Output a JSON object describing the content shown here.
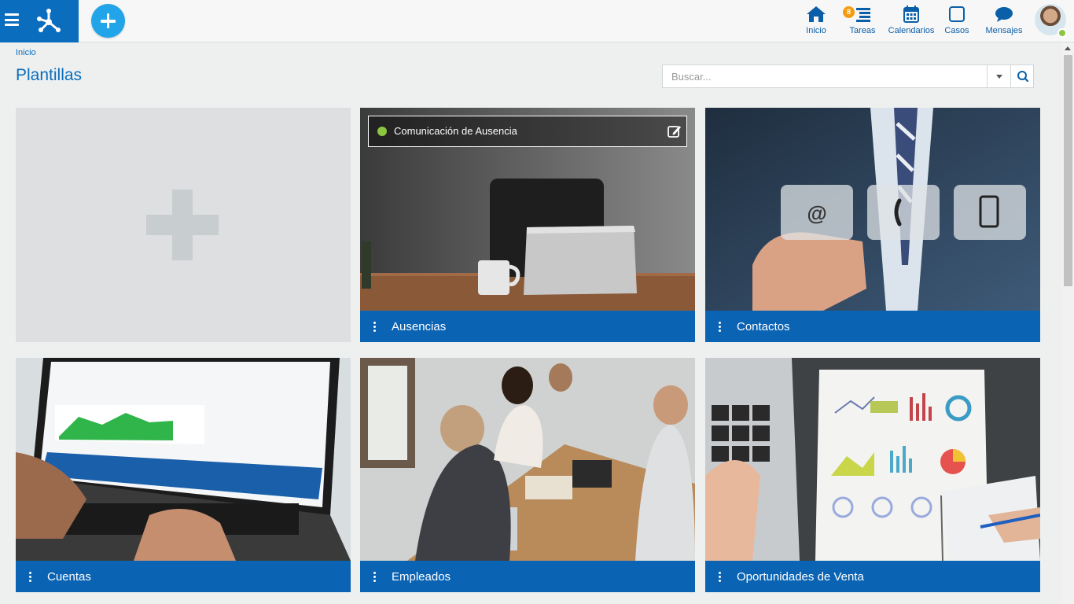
{
  "app": {
    "nav": [
      {
        "label": "Inicio",
        "icon": "home-icon"
      },
      {
        "label": "Tareas",
        "icon": "tasks-icon",
        "badge": "8"
      },
      {
        "label": "Calendarios",
        "icon": "calendar-icon"
      },
      {
        "label": "Casos",
        "icon": "cases-icon"
      },
      {
        "label": "Mensajes",
        "icon": "messages-icon"
      }
    ],
    "user_status_color": "#8cc63f"
  },
  "header": {
    "breadcrumb": "Inicio",
    "title": "Plantillas"
  },
  "search": {
    "placeholder": "Buscar..."
  },
  "cards": [
    {
      "title": "Ausencias",
      "overlay_text": "Comunicación de Ausencia",
      "status_color": "#8cc63f"
    },
    {
      "title": "Contactos"
    },
    {
      "title": "Cuentas"
    },
    {
      "title": "Empleados"
    },
    {
      "title": "Oportunidades de Venta"
    }
  ],
  "theme": {
    "primary": "#0a6dbd",
    "card_footer": "#0a63b3",
    "add_button": "#22a4e8"
  }
}
